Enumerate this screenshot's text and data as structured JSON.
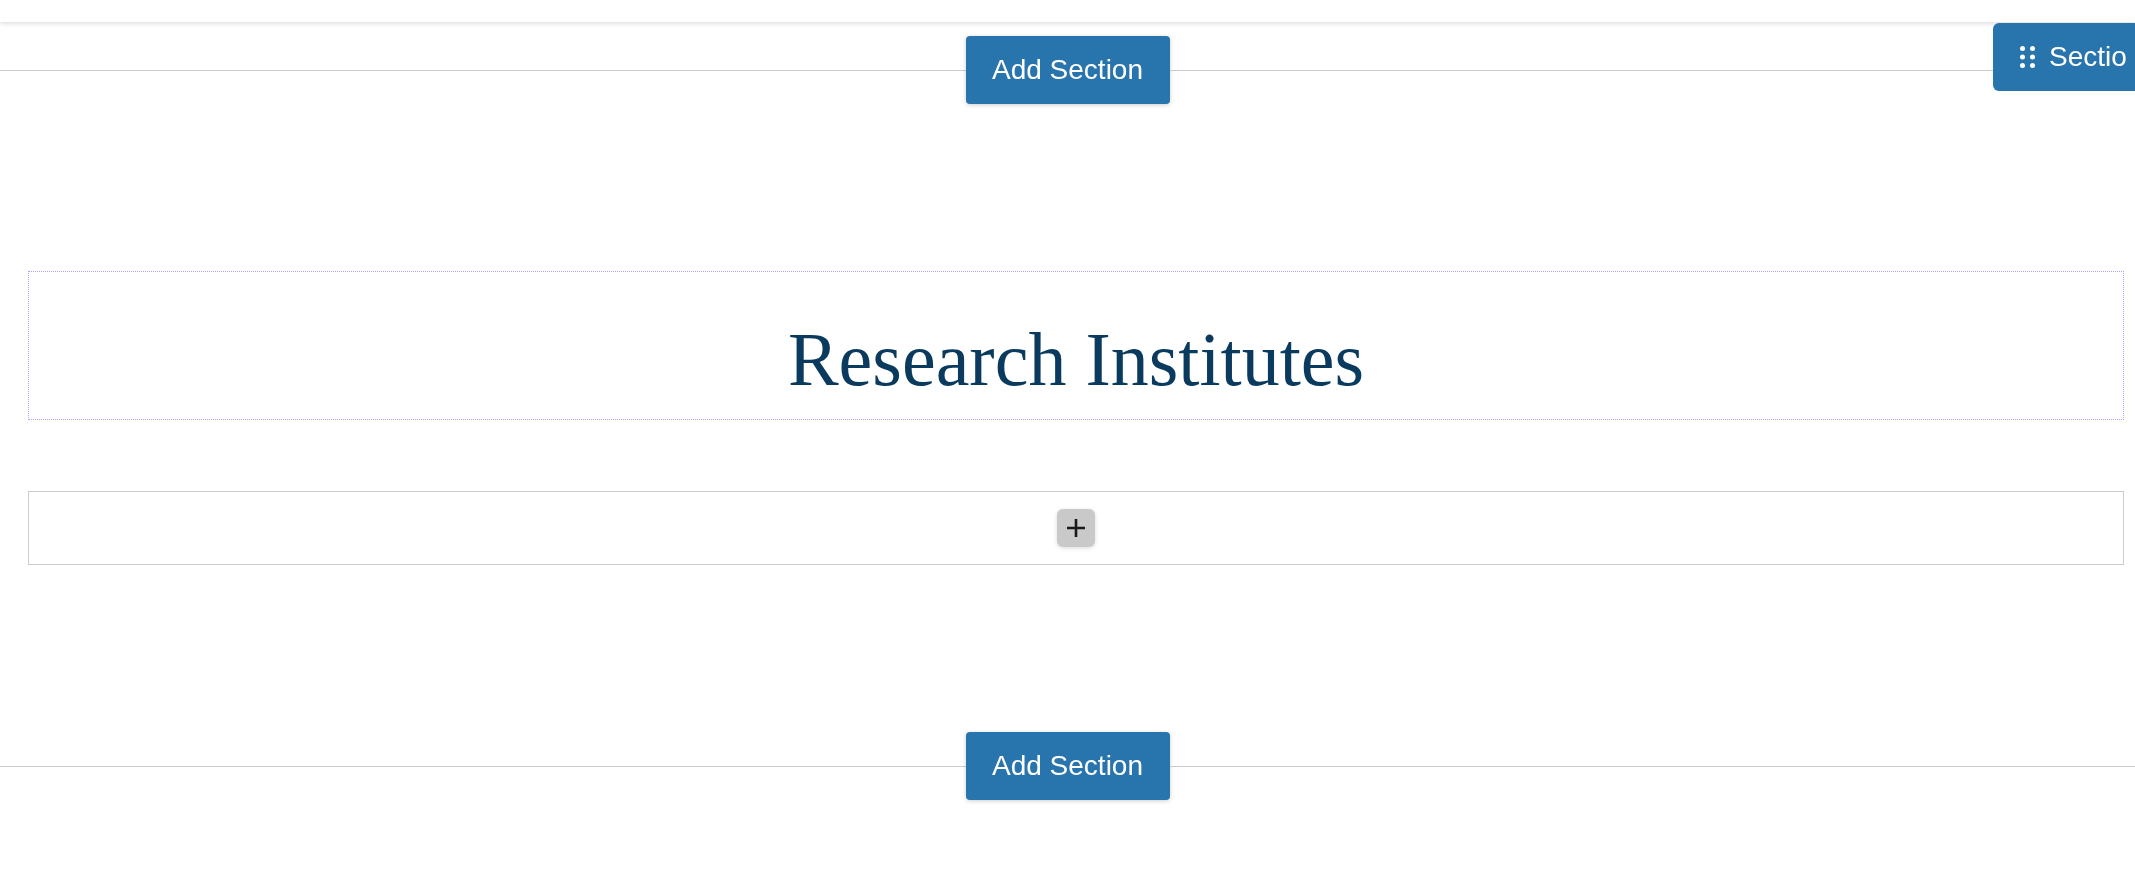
{
  "section_tab": {
    "label": "Sectio"
  },
  "add_section_top": {
    "label": "Add Section"
  },
  "heading_block": {
    "text": "Research Institutes"
  },
  "add_section_bottom": {
    "label": "Add Section"
  }
}
